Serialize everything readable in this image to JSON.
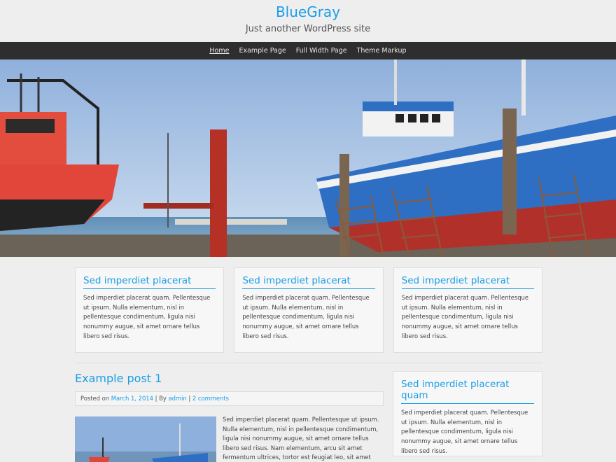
{
  "site": {
    "title": "BlueGray",
    "tagline": "Just another WordPress site"
  },
  "nav": {
    "items": [
      "Home",
      "Example Page",
      "Full Width Page",
      "Theme Markup"
    ]
  },
  "hero": {
    "description_hidden": ""
  },
  "widgets": [
    {
      "title": "Sed imperdiet placerat",
      "text": "Sed imperdiet placerat quam. Pellentesque ut ipsum. Nulla elementum, nisl in pellentesque condimentum, ligula nisi nonummy augue, sit amet ornare tellus libero sed risus."
    },
    {
      "title": "Sed imperdiet placerat",
      "text": "Sed imperdiet placerat quam. Pellentesque ut ipsum. Nulla elementum, nisl in pellentesque condimentum, ligula nisi nonummy augue, sit amet ornare tellus libero sed risus."
    },
    {
      "title": "Sed imperdiet placerat",
      "text": "Sed imperdiet placerat quam. Pellentesque ut ipsum. Nulla elementum, nisl in pellentesque condimentum, ligula nisi nonummy augue, sit amet ornare tellus libero sed risus."
    }
  ],
  "post": {
    "title": "Example post 1",
    "posted_on_label": "Posted on",
    "date": "March 1, 2014",
    "by_label": "| By",
    "author": "admin",
    "sep": "|",
    "comments": "2 comments",
    "excerpt": "Sed imperdiet placerat quam. Pellentesque ut ipsum. Nulla elementum, nisl in pellentesque condimentum, ligula nisi nonummy augue, sit amet ornare tellus libero sed risus. Nam elementum, arcu sit amet fermentum ultrices, tortor est feugiat leo, sit amet"
  },
  "sidebar": {
    "title": "Sed imperdiet placerat quam",
    "text": "Sed imperdiet placerat quam. Pellentesque ut ipsum. Nulla elementum, nisl in pellentesque condimentum, ligula nisi nonummy augue, sit amet ornare tellus libero sed risus."
  },
  "colors": {
    "accent": "#1a9ee6",
    "nav_bg": "#2e2e2e",
    "page_bg": "#eeeeee"
  }
}
